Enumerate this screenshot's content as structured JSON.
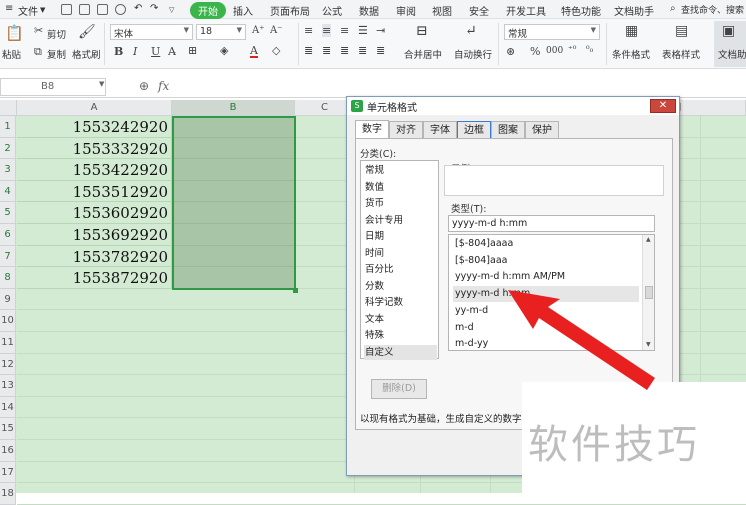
{
  "menubar": {
    "file": "文件",
    "tabs": [
      "开始",
      "插入",
      "页面布局",
      "公式",
      "数据",
      "审阅",
      "视图",
      "安全",
      "开发工具",
      "特色功能",
      "文档助手"
    ],
    "search": "查找命令、搜索"
  },
  "ribbon": {
    "paste": "粘贴",
    "cut": "剪切",
    "copy": "复制",
    "format_painter": "格式刷",
    "font_name": "宋体",
    "font_size": "18",
    "bold": "B",
    "italic": "I",
    "underline": "U",
    "grow_font": "A⁺",
    "shrink_font": "A⁻",
    "merge_center": "合并居中",
    "wrap_text": "自动换行",
    "number_format": "常规",
    "percent": "%",
    "thousands": "000",
    "cond_format": "条件格式",
    "table_style": "表格样式",
    "doc_helper": "文档助"
  },
  "formula_bar": {
    "name_box": "B8",
    "fx": "fx"
  },
  "grid": {
    "columns": [
      "A",
      "B",
      "C"
    ],
    "rows": [
      "1",
      "2",
      "3",
      "4",
      "5",
      "6",
      "7",
      "8",
      "9",
      "10",
      "11",
      "12",
      "13",
      "14",
      "15",
      "16",
      "17",
      "18"
    ],
    "values": [
      "1553242920",
      "1553332920",
      "1553422920",
      "1553512920",
      "1553602920",
      "1553692920",
      "1553782920",
      "1553872920"
    ]
  },
  "dialog": {
    "title": "单元格格式",
    "close": "✕",
    "tabs": [
      "数字",
      "对齐",
      "字体",
      "边框",
      "图案",
      "保护"
    ],
    "category_label": "分类(C):",
    "categories": [
      "常规",
      "数值",
      "货币",
      "会计专用",
      "日期",
      "时间",
      "百分比",
      "分数",
      "科学记数",
      "文本",
      "特殊",
      "自定义"
    ],
    "sample_label": "示例",
    "type_label": "类型(T):",
    "type_value": "yyyy-m-d h:mm",
    "type_list": [
      "[$-804]aaaa",
      "[$-804]aaa",
      "yyyy-m-d h:mm AM/PM",
      "yyyy-m-d h:mm",
      "yy-m-d",
      "m-d",
      "m-d-yy"
    ],
    "delete_button": "删除(D)",
    "note": "以现有格式为基础，生成自定义的数字格式"
  },
  "watermark": "软件技巧",
  "colors": {
    "accent_green": "#39b54a",
    "grid_fill": "#d4ebd3",
    "selection_fill": "#a9c5a8",
    "arrow_red": "#e8201f"
  }
}
